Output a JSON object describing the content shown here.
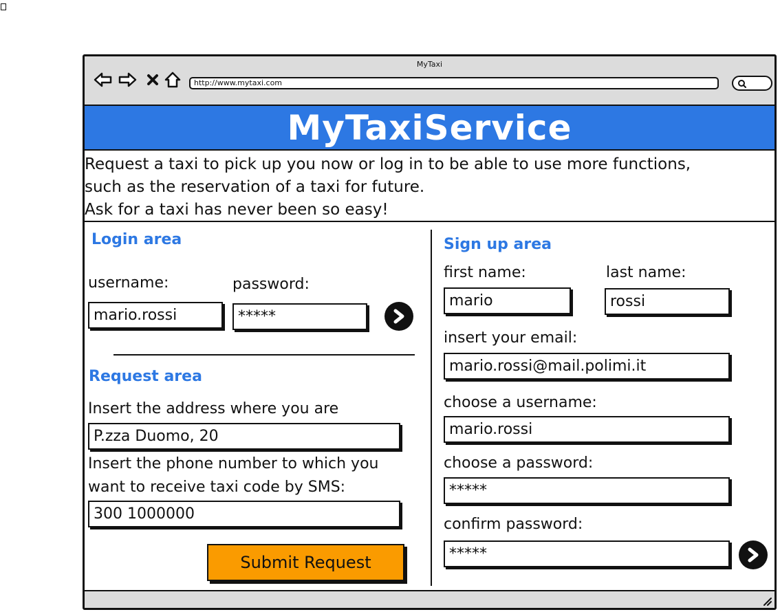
{
  "browser": {
    "window_title": "MyTaxi",
    "url": "http://www.mytaxi.com",
    "icons": [
      "back-arrow-icon",
      "forward-arrow-icon",
      "close-icon",
      "home-icon",
      "search-icon",
      "resize-grip-icon"
    ]
  },
  "header": {
    "title": "MyTaxiService",
    "intro_lines": [
      "Request a taxi to pick up you now or log in to be able to use more functions,",
      "such as the reservation of a taxi for future.",
      "Ask for a taxi has never been so easy!"
    ]
  },
  "login": {
    "title": "Login area",
    "username_label": "username:",
    "username_value": "mario.rossi",
    "password_label": "password:",
    "password_value": "*****"
  },
  "request": {
    "title": "Request area",
    "address_label": "Insert the address where you are",
    "address_value": "P.zza Duomo, 20",
    "phone_label_line1": "Insert the phone number to which you",
    "phone_label_line2": "want to receive taxi code by SMS:",
    "phone_value": "300 1000000",
    "submit_label": "Submit Request"
  },
  "signup": {
    "title": "Sign up area",
    "first_name_label": "first name:",
    "first_name_value": "mario",
    "last_name_label": "last name:",
    "last_name_value": "rossi",
    "email_label": "insert your email:",
    "email_value": "mario.rossi@mail.polimi.it",
    "username_label": "choose a username:",
    "username_value": "mario.rossi",
    "password_label": "choose a password:",
    "password_value": "*****",
    "confirm_label": "confirm password:",
    "confirm_value": "*****"
  },
  "colors": {
    "accent_blue": "#2d78e3",
    "button_orange": "#fa9b00",
    "chrome_gray": "#dcdcdc"
  }
}
